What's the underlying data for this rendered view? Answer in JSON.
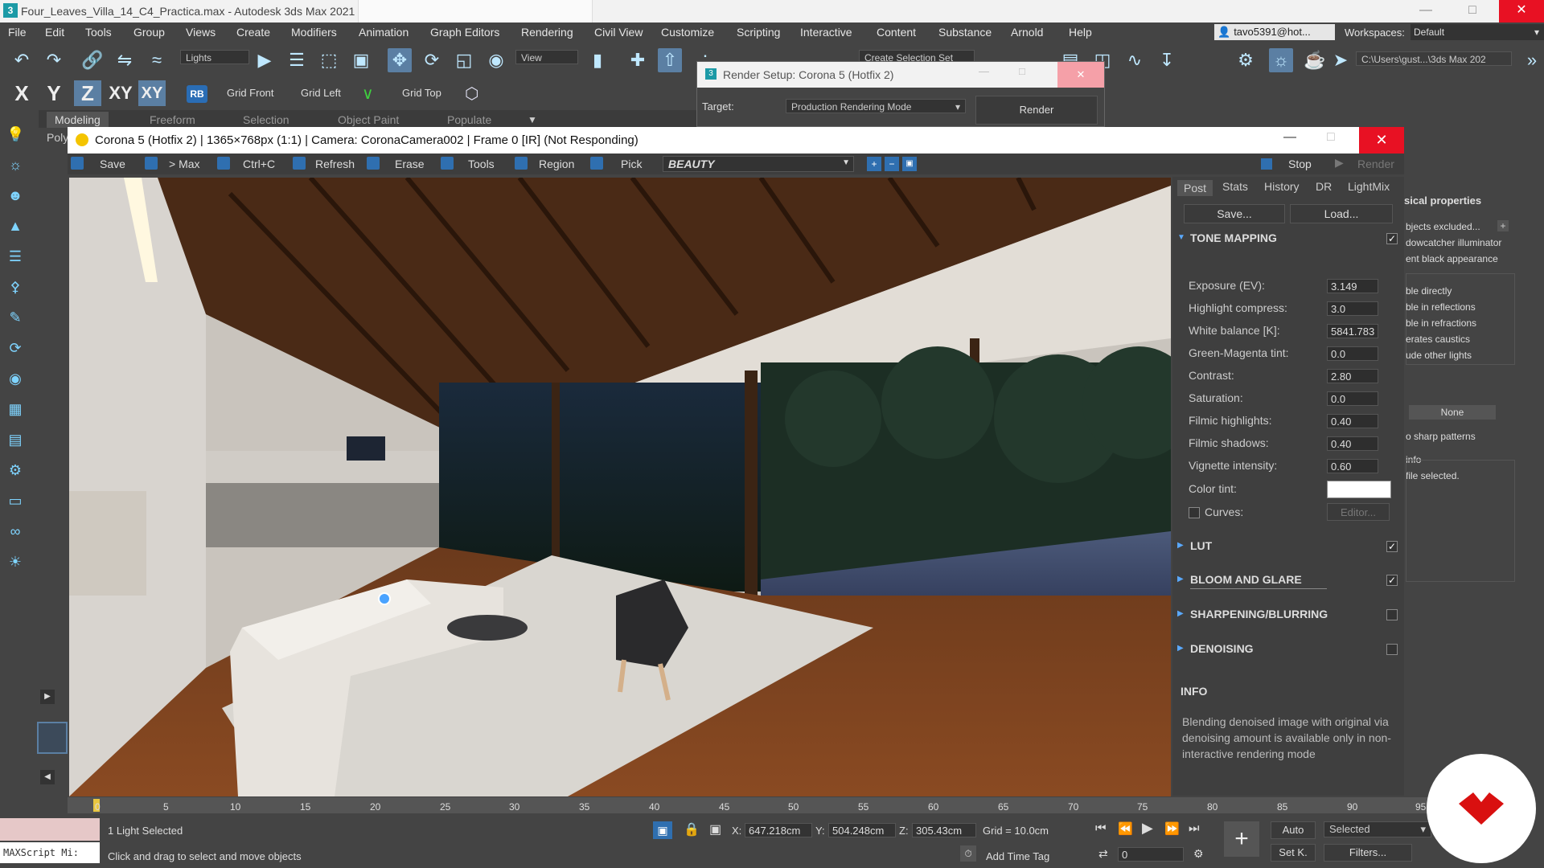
{
  "window": {
    "title": "Four_Leaves_Villa_14_C4_Practica.max - Autodesk 3ds Max 2021",
    "app_icon": "3"
  },
  "menu": [
    "File",
    "Edit",
    "Tools",
    "Group",
    "Views",
    "Create",
    "Modifiers",
    "Animation",
    "Graph Editors",
    "Rendering",
    "Civil View",
    "Customize",
    "Scripting",
    "Interactive",
    "Content",
    "Substance",
    "Arnold",
    "Help"
  ],
  "user": "tavo5391@hot...",
  "workspaces": {
    "label": "Workspaces:",
    "value": "Default"
  },
  "toolbar": {
    "selection_filter": "Lights",
    "ref_coord": "View",
    "selection_set": "Create Selection Set",
    "path": "C:\\Users\\gust...\\3ds Max 202"
  },
  "toolbar2": {
    "axes": [
      "X",
      "Y",
      "Z",
      "XY",
      "XY"
    ],
    "rb": "RB",
    "grid_front": "Grid Front",
    "grid_left": "Grid Left",
    "grid_top": "Grid Top"
  },
  "ribbon": [
    "Modeling",
    "Freeform",
    "Selection",
    "Object Paint",
    "Populate"
  ],
  "ribbon_sub": "Poly",
  "render_setup": {
    "title": "Render Setup: Corona 5 (Hotfix 2)",
    "target_label": "Target:",
    "target_value": "Production Rendering Mode",
    "render_button": "Render"
  },
  "vfb": {
    "title": "Corona 5 (Hotfix 2) | 1365×768px (1:1) | Camera: CoronaCamera002 | Frame 0 [IR] (Not Responding)",
    "toolbar": {
      "save": "Save",
      "to_max": "> Max",
      "copy": "Ctrl+C",
      "refresh": "Refresh",
      "erase": "Erase",
      "tools": "Tools",
      "region": "Region",
      "pick": "Pick",
      "pass": "BEAUTY",
      "stop": "Stop",
      "render": "Render"
    },
    "tabs": [
      "Post",
      "Stats",
      "History",
      "DR",
      "LightMix"
    ],
    "save_btn": "Save...",
    "load_btn": "Load...",
    "tone_mapping": {
      "title": "TONE MAPPING",
      "enabled": true,
      "props": [
        {
          "label": "Exposure (EV):",
          "value": "3.149"
        },
        {
          "label": "Highlight compress:",
          "value": "3.0"
        },
        {
          "label": "White balance [K]:",
          "value": "5841.783"
        },
        {
          "label": "Green-Magenta tint:",
          "value": "0.0"
        },
        {
          "label": "Contrast:",
          "value": "2.80"
        },
        {
          "label": "Saturation:",
          "value": "0.0"
        },
        {
          "label": "Filmic highlights:",
          "value": "0.40"
        },
        {
          "label": "Filmic shadows:",
          "value": "0.40"
        },
        {
          "label": "Vignette intensity:",
          "value": "0.60"
        }
      ],
      "color_tint_label": "Color tint:",
      "color_tint": "#ffffff",
      "curves_label": "Curves:",
      "editor_btn": "Editor..."
    },
    "sections": [
      {
        "title": "LUT",
        "checked": true
      },
      {
        "title": "BLOOM AND GLARE",
        "checked": true
      },
      {
        "title": "SHARPENING/BLURRING",
        "checked": false
      },
      {
        "title": "DENOISING",
        "checked": false
      }
    ],
    "info": {
      "title": "INFO",
      "text": "Blending denoised image with original via denoising amount is available only in non-interactive rendering mode"
    }
  },
  "behind_panel": {
    "title": "sical properties",
    "lines": [
      "bjects excluded...",
      "dowcatcher illuminator",
      "ent black appearance",
      "ble directly",
      "ble in reflections",
      "ble in refractions",
      "erates caustics",
      "ude other lights"
    ],
    "none": "None",
    "sharp": "o sharp patterns",
    "info": "info",
    "file": "file selected."
  },
  "timeline": {
    "ticks": [
      "0",
      "5",
      "10",
      "15",
      "20",
      "25",
      "30",
      "35",
      "40",
      "45",
      "50",
      "55",
      "60",
      "65",
      "70",
      "75",
      "80",
      "85",
      "90",
      "95"
    ]
  },
  "status": {
    "maxscript": "MAXScript Mi:",
    "selection": "1 Light Selected",
    "prompt": "Click and drag to select and move objects",
    "x_label": "X:",
    "x": "647.218cm",
    "y_label": "Y:",
    "y": "504.248cm",
    "z_label": "Z:",
    "z": "305.43cm",
    "grid": "Grid = 10.0cm",
    "add_time_tag": "Add Time Tag",
    "auto": "Auto",
    "set_key": "Set K.",
    "selected": "Selected",
    "filters": "Filters...",
    "frame": "0"
  },
  "colors": {
    "accent": "#5b7fa3",
    "close": "#e81123",
    "brand": "#d91010"
  }
}
